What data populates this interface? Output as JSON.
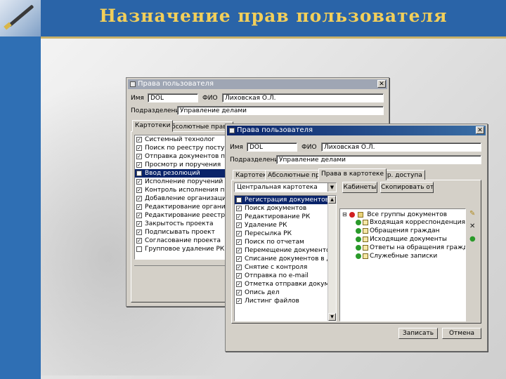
{
  "slide": {
    "title": "Назначение прав пользователя",
    "colors": {
      "header_bg": "#2a64a8",
      "title_color": "#f2cf5a",
      "accent_line": "#c9b26a"
    }
  },
  "back_window": {
    "title": "Права пользователя",
    "name_label": "Имя",
    "name_value": "DOL",
    "fio_label": "ФИО",
    "fio_value": "Лиховская О.Л.",
    "dept_label": "Подразделение",
    "dept_value": "Управление делами",
    "tabs": [
      "Картотеки",
      "Абсолютные права"
    ],
    "rights": [
      {
        "label": "Системный технолог",
        "checked": true
      },
      {
        "label": "Поиск по реестру поступивших",
        "checked": true
      },
      {
        "label": "Отправка документов по реестру",
        "checked": true
      },
      {
        "label": "Просмотр и поручения",
        "checked": true
      },
      {
        "label": "Ввод резолюций",
        "checked": true,
        "selected": true
      },
      {
        "label": "Исполнение поручений",
        "checked": true
      },
      {
        "label": "Контроль исполнения поручений",
        "checked": true
      },
      {
        "label": "Добавление организаций в группы",
        "checked": true
      },
      {
        "label": "Редактирование организаций",
        "checked": true
      },
      {
        "label": "Редактирование реестров",
        "checked": true
      },
      {
        "label": "Закрытость проекта",
        "checked": true
      },
      {
        "label": "Подписывать проект",
        "checked": true
      },
      {
        "label": "Согласование проекта",
        "checked": true
      },
      {
        "label": "Групповое удаление РК",
        "checked": false
      }
    ]
  },
  "front_window": {
    "title": "Права пользователя",
    "name_label": "Имя",
    "name_value": "DOL",
    "fio_label": "ФИО",
    "fio_value": "Лиховская О.Л.",
    "dept_label": "Подразделение",
    "dept_value": "Управление делами",
    "tabs": [
      "Картотеки",
      "Абсолютные права",
      "Права в картотеке",
      "Огр. доступа"
    ],
    "active_tab_index": 2,
    "combo_value": "Центральная картотека",
    "buttons": {
      "cabinets": "Кабинеты",
      "copy_from": "Скопировать от...",
      "apply": "Записать",
      "cancel": "Отмена"
    },
    "rights": [
      {
        "label": "Регистрация документов",
        "checked": true,
        "selected": true
      },
      {
        "label": "Поиск документов",
        "checked": true
      },
      {
        "label": "Редактирование РК",
        "checked": true
      },
      {
        "label": "Удаление РК",
        "checked": true
      },
      {
        "label": "Пересылка РК",
        "checked": true
      },
      {
        "label": "Поиск по отчетам",
        "checked": true
      },
      {
        "label": "Перемещение документов",
        "checked": true
      },
      {
        "label": "Списание документов в дело",
        "checked": true
      },
      {
        "label": "Снятие с контроля",
        "checked": true
      },
      {
        "label": "Отправка по e-mail",
        "checked": true
      },
      {
        "label": "Отметка отправки документов",
        "checked": true
      },
      {
        "label": "Опись дел",
        "checked": true
      },
      {
        "label": "Листинг файлов",
        "checked": true
      }
    ],
    "tree": {
      "root": "Все группы документов",
      "children": [
        "Входящая корреспонденция",
        "Обращения граждан",
        "Исходящие документы",
        "Ответы на обращения граждан",
        "Служебные записки"
      ]
    },
    "icons": [
      "add-icon",
      "delete-icon",
      "help-icon"
    ]
  }
}
